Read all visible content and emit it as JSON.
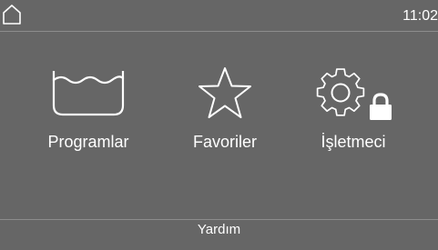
{
  "status_bar": {
    "home_icon": "home-icon",
    "time": "11:02"
  },
  "tiles": [
    {
      "label": "Programlar",
      "icon": "wash-tub-icon"
    },
    {
      "label": "Favoriler",
      "icon": "star-icon"
    },
    {
      "label": "İşletmeci",
      "icon": "gear-lock-icon"
    }
  ],
  "footer": {
    "help_label": "Yardım"
  },
  "colors": {
    "background": "#666666",
    "foreground": "#ffffff",
    "divider": "#8c8c8c"
  }
}
